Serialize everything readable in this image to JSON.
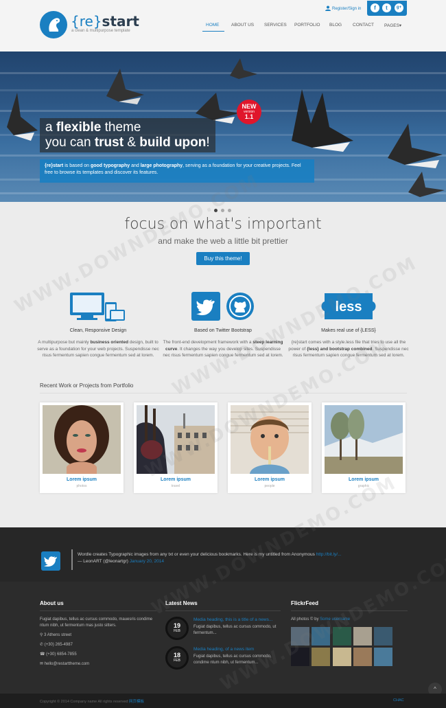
{
  "brand": {
    "open_brace": "{re}",
    "name": "start",
    "tagline": "a clean & multipurpose template"
  },
  "topbar": {
    "register_label": "Register/Sign in",
    "social": [
      "f",
      "t",
      "g+"
    ]
  },
  "nav": {
    "items": [
      "HOME",
      "ABOUT US",
      "SERVICES",
      "PORTFOLIO",
      "BLOG",
      "CONTACT",
      "PAGES▾"
    ],
    "active": "HOME"
  },
  "hero": {
    "line1_pre": "a ",
    "line1_bold": "flexible",
    "line1_post": " theme",
    "line2_pre": "you can ",
    "line2_bold1": "trust",
    "line2_mid": " & ",
    "line2_bold2": "build upon",
    "line2_post": "!",
    "sub_brand": "{re}start",
    "sub_a": " is based on ",
    "sub_b1": "good typography",
    "sub_c": " and ",
    "sub_b2": "large photography",
    "sub_d": ", serving as a foundation for your creative projects. Feel free to browse its templates and discover its features.",
    "badge_new": "NEW",
    "badge_version": "version",
    "badge_num": "1.1"
  },
  "intro": {
    "title": "focus on what's important",
    "subtitle": "and make the web a little bit prettier",
    "button": "Buy this theme!"
  },
  "features": [
    {
      "icon": "devices-icon",
      "title": "Clean, Responsive Design",
      "pre": "A multipurpose but mainly ",
      "bold": "business oriented",
      "post": " design, built to serve as a foundation for your web projects. Suspendisse nec risus fermentum sapien congue fermentum sed at lorem."
    },
    {
      "icon": "twitter-github-icon",
      "title": "Based on Twitter Bootstrap",
      "pre": "The front-end development framework with a ",
      "bold": "steep learning curve",
      "post": ". It changes the way you develop sites. Suspendisse nec risus fermentum sapien congue fermentum sed at lorem."
    },
    {
      "icon": "less-icon",
      "title": "Makes real use of {LESS}",
      "pre": "{re}start comes with a style.less file that tries to use all the power of ",
      "bold": "{less} and bootstrap combined",
      "post": ". Suspendisse nec risus fermentum sapien congue fermentum sed at lorem."
    }
  ],
  "portfolio": {
    "heading": "Recent Work or Projects from Portfolio",
    "items": [
      {
        "title": "Lorem ipsum",
        "category": "photos"
      },
      {
        "title": "Lorem ipsum",
        "category": "travel"
      },
      {
        "title": "Lorem ipsum",
        "category": "people"
      },
      {
        "title": "Lorem ipsum",
        "category": "graphic"
      }
    ]
  },
  "tweet": {
    "text": "Wordle creates Typographic images from any txt or even your delicious bookmarks. Here is my untitled from Anonymous",
    "link": "http://bit.ly/...",
    "author": "— LeonART (@leonartgr)",
    "date": "January 20, 2014"
  },
  "footer": {
    "about": {
      "heading": "About us",
      "text": "Fugiat dapibus, tellus ac cursus commodo, mauesris condime ntum nibh, ut fermentum mas justo sitters.",
      "address": "3 Athens street",
      "phone": "(+30) 265-4987",
      "fax": "(+30) 6854-7855",
      "email": "hello@restarttheme.com"
    },
    "news": {
      "heading": "Latest News",
      "items": [
        {
          "day": "19",
          "month": "FEB",
          "title": "Media heading, this is a title of a news...",
          "text": "Fugiat dapibus, tellus ac cursus commodo, ut fermentum..."
        },
        {
          "day": "18",
          "month": "FEB",
          "title": "Media heading, of a news item",
          "text": "Fugiat dapibus, tellus ac cursus commodo, condime ntum nibh, ut fermentum..."
        }
      ]
    },
    "flickr": {
      "heading": "FlickrFeed",
      "caption_pre": "All photos © by ",
      "caption_link": "Some username"
    }
  },
  "copyright": {
    "text": "Copyright © 2014 Company name All rights reserved",
    "link": "网页模板",
    "right": "CHAC"
  },
  "to_top": "^",
  "watermarks": [
    "WWW.DOWNDEMO.COM",
    "WWW.DOWNDEMO.COM",
    "WWW.DOWNDEMO.COM",
    "WWW.DOWNDEMO.COM",
    "WWW.DOWNDEMO.COM"
  ],
  "colors": {
    "accent": "#1a7fc1",
    "badge": "#e0162b",
    "dark": "#2c2c2c"
  }
}
